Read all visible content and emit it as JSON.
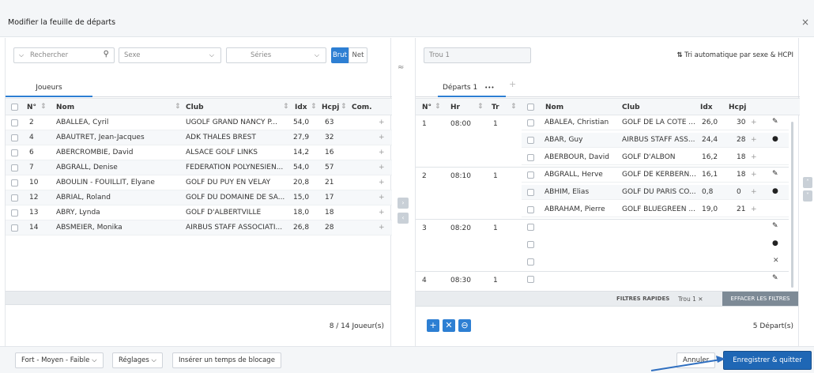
{
  "dialog": {
    "title": "Modifier la feuille de départs",
    "close": "×"
  },
  "left": {
    "search_placeholder": "Rechercher",
    "sexe_placeholder": "Sexe",
    "series_placeholder": "Séries",
    "brut_label": "Brut",
    "net_label": "Net",
    "tab_label": "Joueurs",
    "columns": {
      "num": "N°",
      "nom": "Nom",
      "club": "Club",
      "idx": "Idx",
      "hcpj": "Hcpj",
      "com": "Com."
    },
    "rows": [
      {
        "num": "2",
        "nom": "ABALLEA, Cyril",
        "club": "UGOLF GRAND NANCY P...",
        "idx": "54,0",
        "hcpj": "63"
      },
      {
        "num": "4",
        "nom": "ABAUTRET, Jean-Jacques",
        "club": "ADK THALES BREST",
        "idx": "27,9",
        "hcpj": "32"
      },
      {
        "num": "6",
        "nom": "ABERCROMBIE, David",
        "club": "ALSACE GOLF LINKS",
        "idx": "14,2",
        "hcpj": "16"
      },
      {
        "num": "7",
        "nom": "ABGRALL, Denise",
        "club": "FEDERATION POLYNESIEN...",
        "idx": "54,0",
        "hcpj": "57"
      },
      {
        "num": "10",
        "nom": "ABOULIN - FOUILLIT, Elyane",
        "club": "GOLF DU PUY EN VELAY",
        "idx": "20,8",
        "hcpj": "21"
      },
      {
        "num": "12",
        "nom": "ABRIAL, Roland",
        "club": "GOLF DU DOMAINE DE SA...",
        "idx": "15,0",
        "hcpj": "17"
      },
      {
        "num": "13",
        "nom": "ABRY, Lynda",
        "club": "GOLF D'ALBERTVILLE",
        "idx": "18,0",
        "hcpj": "18"
      },
      {
        "num": "14",
        "nom": "ABSMEIER, Monika",
        "club": "AIRBUS STAFF ASSOCIATI...",
        "idx": "26,8",
        "hcpj": "28"
      }
    ],
    "count": "8 / 14 Joueur(s)"
  },
  "right": {
    "trou_value": "Trou 1",
    "sort_label": "Tri automatique par sexe & HCPI",
    "tab_label": "Départs 1",
    "tab_more": "•••",
    "tab_add": "+",
    "columns": {
      "num": "N°",
      "hr": "Hr",
      "tr": "Tr",
      "nom": "Nom",
      "club": "Club",
      "idx": "Idx",
      "hcpj": "Hcpj"
    },
    "groups": [
      {
        "num": "1",
        "hr": "08:00",
        "tr": "1",
        "players": [
          {
            "nom": "ABALEA, Christian",
            "club": "GOLF DE LA COTE ...",
            "idx": "26,0",
            "hcpj": "30"
          },
          {
            "nom": "ABAR, Guy",
            "club": "AIRBUS STAFF ASS...",
            "idx": "24,4",
            "hcpj": "28"
          },
          {
            "nom": "ABERBOUR, David",
            "club": "GOLF D'ALBON",
            "idx": "16,2",
            "hcpj": "18"
          }
        ]
      },
      {
        "num": "2",
        "hr": "08:10",
        "tr": "1",
        "players": [
          {
            "nom": "ABGRALL, Herve",
            "club": "GOLF DE KERBERN...",
            "idx": "16,1",
            "hcpj": "18"
          },
          {
            "nom": "ABHIM, Elias",
            "club": "GOLF DU PARIS CO...",
            "idx": "0,8",
            "hcpj": "0"
          },
          {
            "nom": "ABRAHAM, Pierre",
            "club": "GOLF BLUEGREEN ...",
            "idx": "19,0",
            "hcpj": "21"
          }
        ]
      },
      {
        "num": "3",
        "hr": "08:20",
        "tr": "1",
        "players": []
      },
      {
        "num": "4",
        "hr": "08:30",
        "tr": "1",
        "players": []
      }
    ],
    "filters_label": "FILTRES RAPIDES",
    "filter_chip": "Trou 1",
    "clear_filters": "EFFACER LES FILTRES",
    "count": "5 Départ(s)"
  },
  "footer": {
    "mode_label": "Fort - Moyen - Faible",
    "settings_label": "Réglages",
    "insert_label": "Insérer un temps de blocage",
    "cancel_label": "Annuler",
    "save_label": "Enregistrer & quitter"
  },
  "colors": {
    "accent": "#2d7fd3",
    "primary_dark": "#1f67b5",
    "filter_bar": "#e9ecef",
    "clear_btn": "#7d8a96"
  },
  "icons": [
    "search-icon",
    "chevron-down-icon",
    "sort-icon",
    "plus-icon",
    "pencil-icon",
    "circle-icon",
    "close-icon",
    "double-chevron-up-icon",
    "arrow-right-icon",
    "arrow-left-icon"
  ]
}
